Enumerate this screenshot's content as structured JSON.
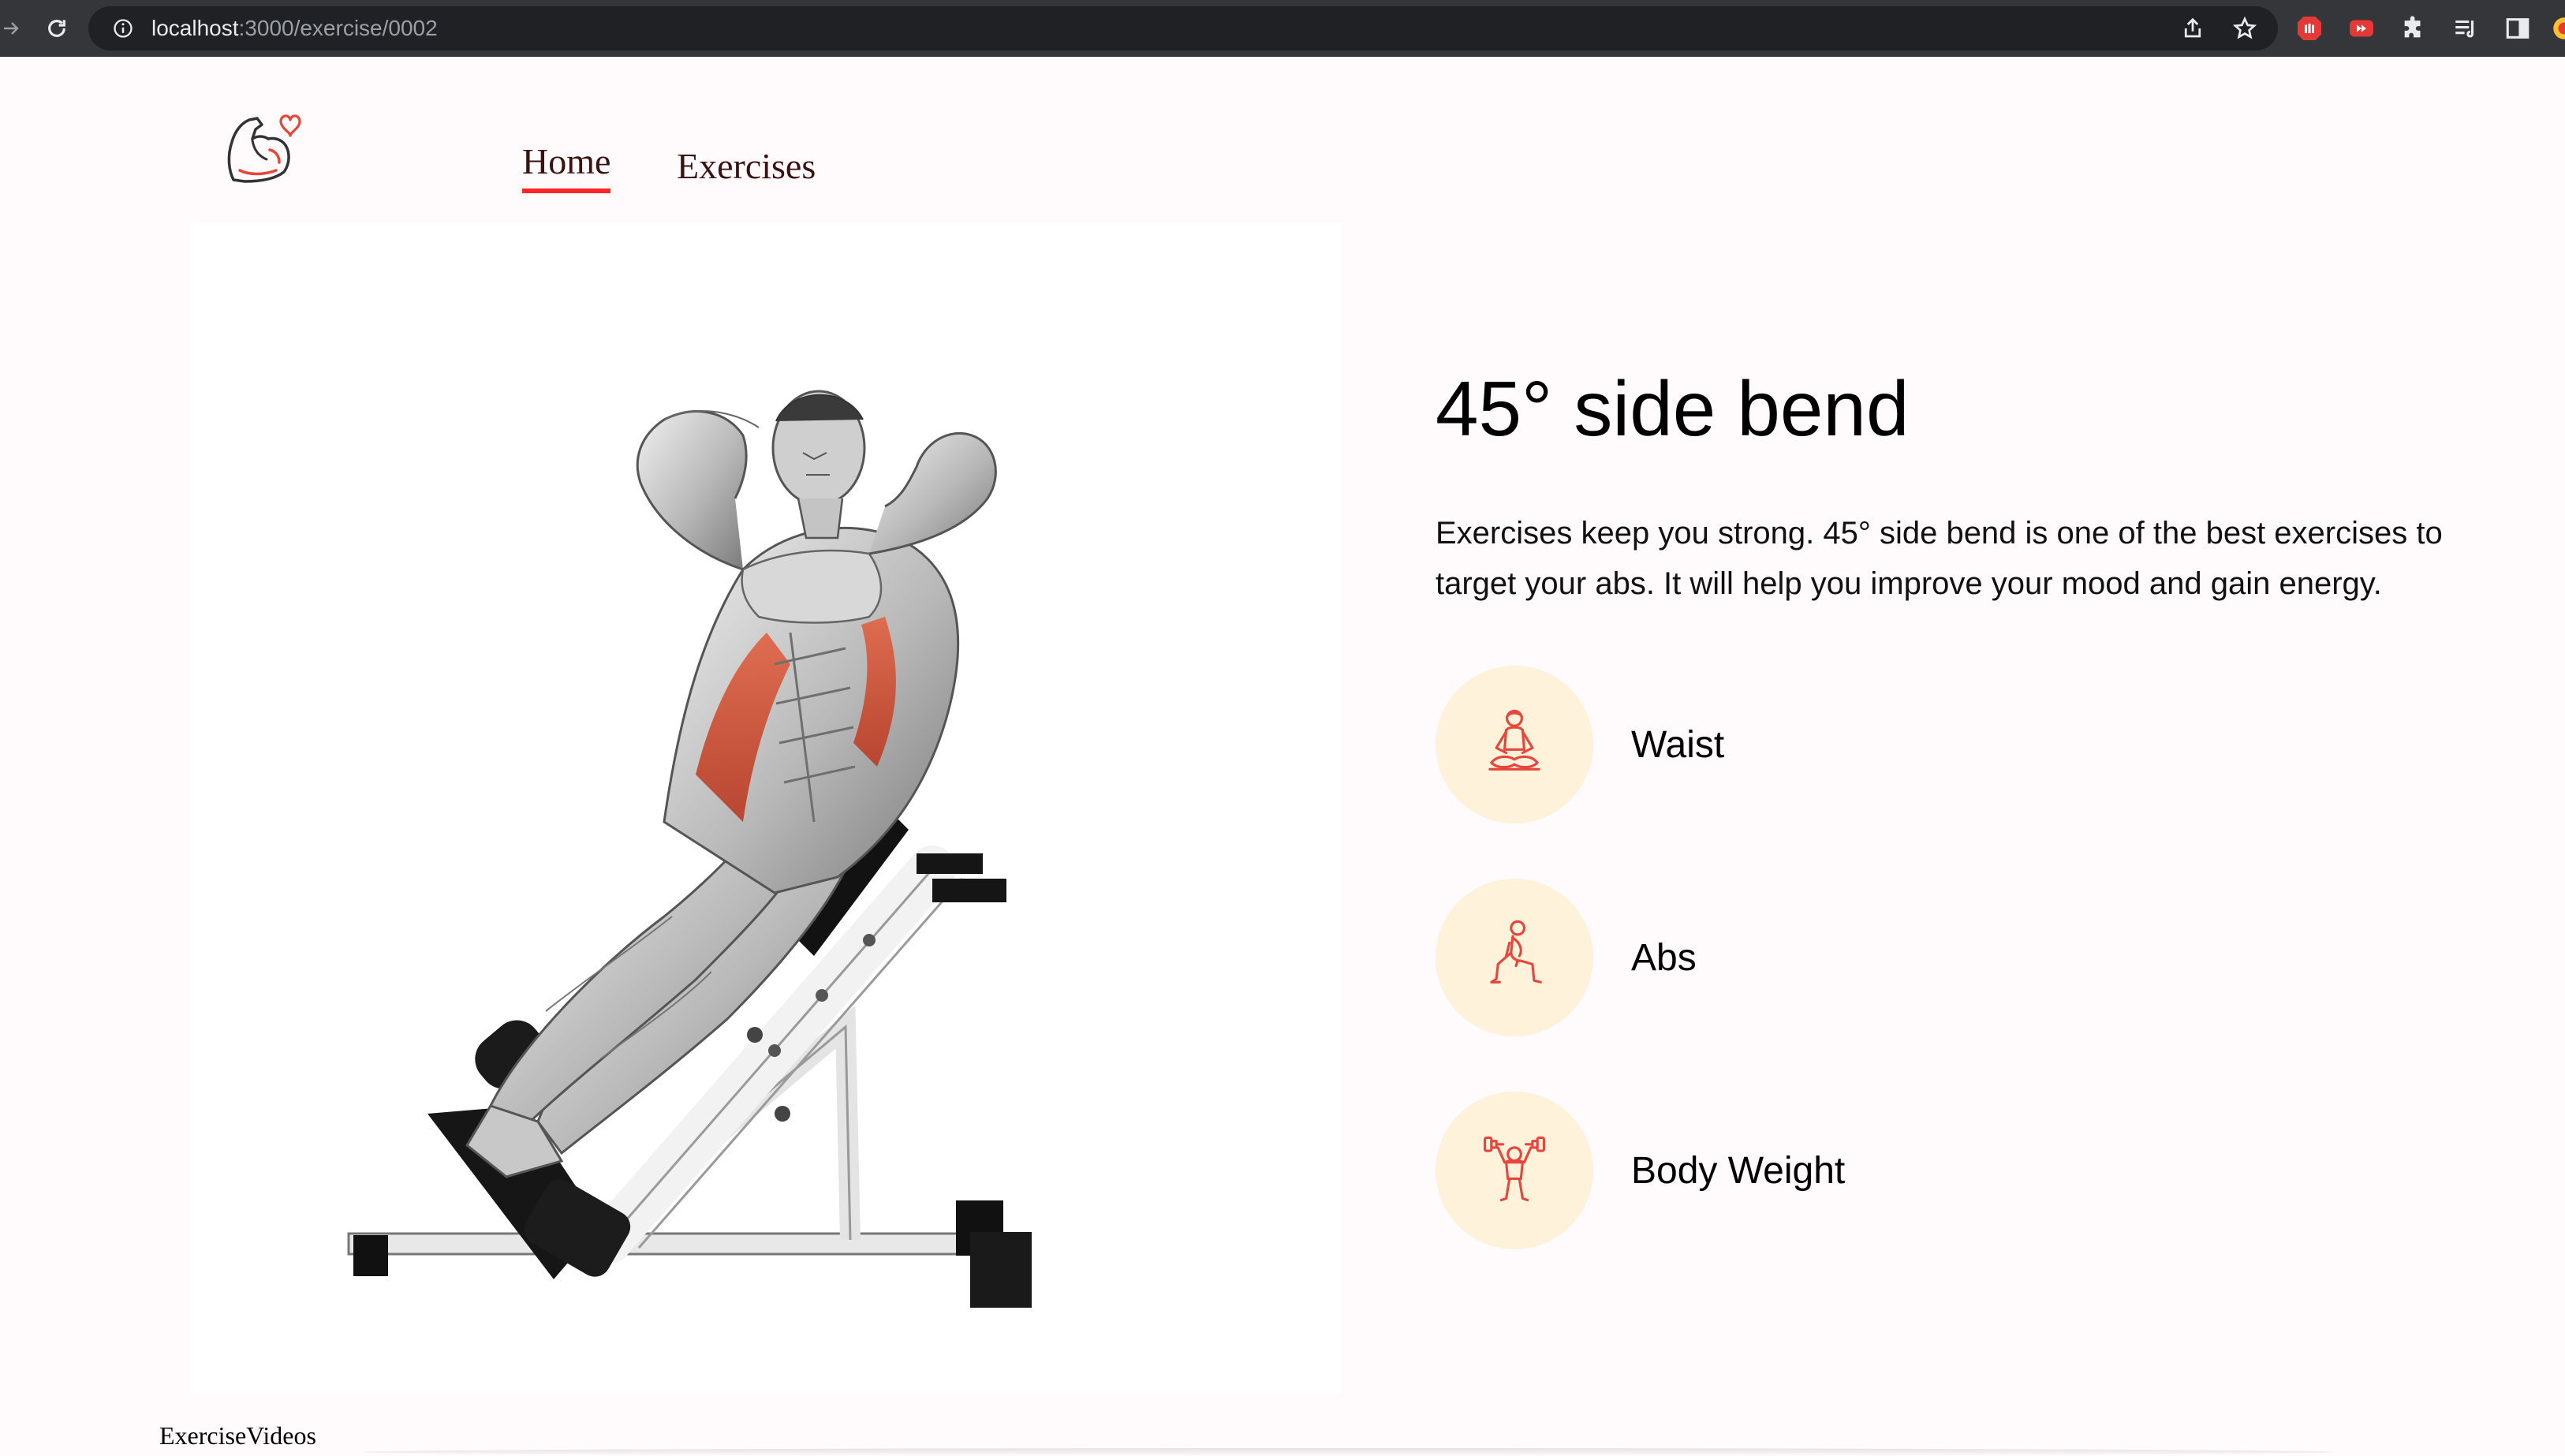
{
  "browser": {
    "url_host": "localhost",
    "url_path": ":3000/exercise/0002"
  },
  "header": {
    "nav": {
      "home_label": "Home",
      "exercises_label": "Exercises"
    }
  },
  "exercise": {
    "name": "45° side bend",
    "description": "Exercises keep you strong. 45° side bend is one of the best exercises to target your abs. It will help you improve your mood and gain energy.",
    "details": [
      {
        "label": "Waist",
        "icon": "meditation-icon"
      },
      {
        "label": "Abs",
        "icon": "lunge-icon"
      },
      {
        "label": "Body Weight",
        "icon": "dumbbell-lift-icon"
      }
    ]
  },
  "videos": {
    "heading": "ExerciseVideos"
  },
  "colors": {
    "accent": "#ff2625",
    "icon_bg": "#fff2db",
    "chrome_bg": "#35363a",
    "omnibox_bg": "#202124",
    "page_bg": "#fffafb",
    "muscle_highlight": "#d9583a"
  }
}
